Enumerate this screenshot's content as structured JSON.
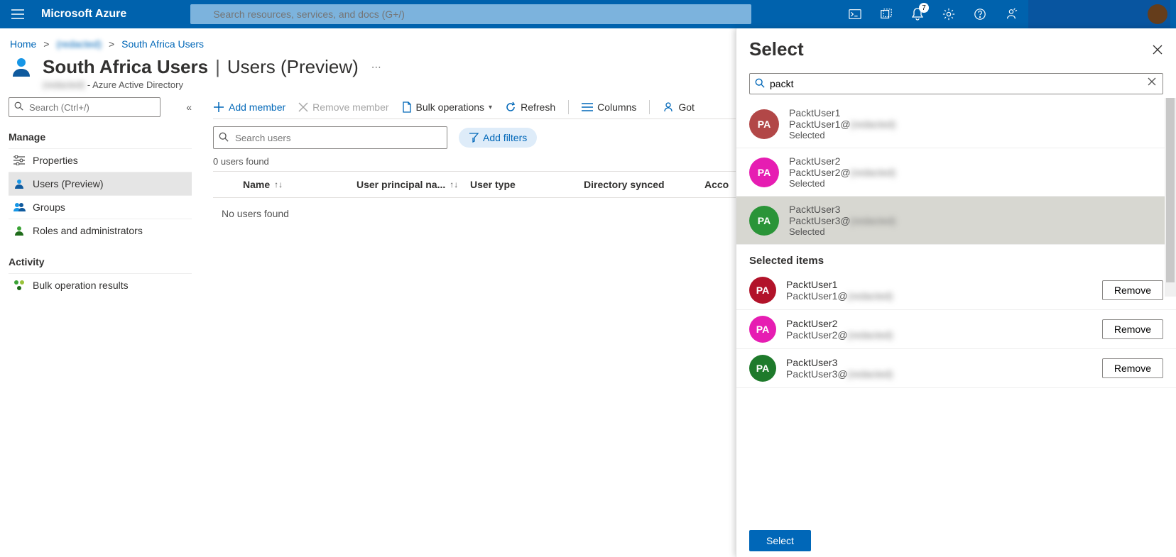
{
  "brand": "Microsoft Azure",
  "global_search_placeholder": "Search resources, services, and docs (G+/)",
  "notification_count": "7",
  "breadcrumb": {
    "home": "Home",
    "tenant_link": "(redacted)",
    "current": "South Africa Users"
  },
  "page": {
    "title_main": "South Africa Users",
    "title_sep": "|",
    "title_sub": "Users (Preview)",
    "subtitle_tenant": "(redacted)",
    "subtitle_suffix": " - Azure Active Directory"
  },
  "sidebar": {
    "search_placeholder": "Search (Ctrl+/)",
    "cat_manage": "Manage",
    "items": [
      {
        "label": "Properties"
      },
      {
        "label": "Users (Preview)"
      },
      {
        "label": "Groups"
      },
      {
        "label": "Roles and administrators"
      }
    ],
    "cat_activity": "Activity",
    "activity_items": [
      {
        "label": "Bulk operation results"
      }
    ]
  },
  "commands": {
    "add": "Add member",
    "remove": "Remove member",
    "bulk": "Bulk operations",
    "refresh": "Refresh",
    "columns": "Columns",
    "feedback": "Got"
  },
  "main": {
    "search_placeholder": "Search users",
    "add_filters": "Add filters",
    "found": "0 users found",
    "cols": {
      "name": "Name",
      "upn": "User principal na...",
      "type": "User type",
      "dsync": "Directory synced",
      "acc": "Acco"
    },
    "empty": "No users found"
  },
  "panel": {
    "title": "Select",
    "search_value": "packt",
    "results": [
      {
        "name": "PacktUser1",
        "email_prefix": "PacktUser1@",
        "email_suffix": "(redacted)",
        "status": "Selected",
        "color": "#b24747",
        "initials": "PA"
      },
      {
        "name": "PacktUser2",
        "email_prefix": "PacktUser2@",
        "email_suffix": "(redacted)",
        "status": "Selected",
        "color": "#e61db2",
        "initials": "PA"
      },
      {
        "name": "PacktUser3",
        "email_prefix": "PacktUser3@",
        "email_suffix": "(redacted)",
        "status": "Selected",
        "color": "#2a9438",
        "initials": "PA"
      }
    ],
    "selected_header": "Selected items",
    "selected": [
      {
        "name": "PacktUser1",
        "email_prefix": "PacktUser1@",
        "email_suffix": "(redacted)",
        "color": "#b2132a",
        "initials": "PA"
      },
      {
        "name": "PacktUser2",
        "email_prefix": "PacktUser2@",
        "email_suffix": "(redacted)",
        "color": "#e61db2",
        "initials": "PA"
      },
      {
        "name": "PacktUser3",
        "email_prefix": "PacktUser3@",
        "email_suffix": "(redacted)",
        "color": "#1e7a2b",
        "initials": "PA"
      }
    ],
    "remove_label": "Remove",
    "select_label": "Select"
  }
}
